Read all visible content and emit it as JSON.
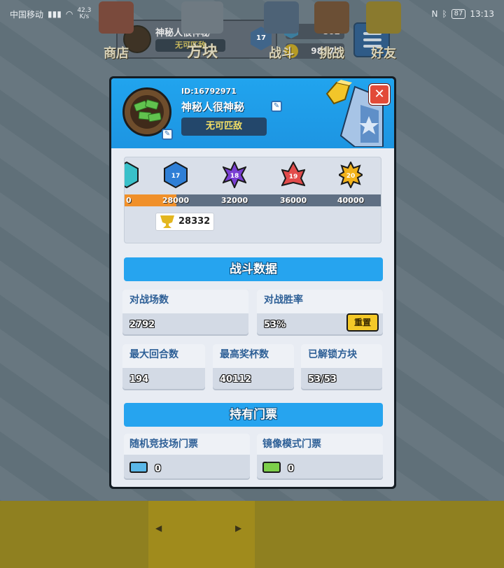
{
  "status_bar": {
    "carrier": "中国移动",
    "net_speed_value": "42.3",
    "net_speed_unit": "K/s",
    "battery": "87",
    "time": "13:13"
  },
  "background_hud": {
    "player_name": "神秘人很神秘",
    "title": "无可匹敌",
    "rank_level": "17",
    "gems": "862",
    "coins": "98176"
  },
  "bottom_nav": {
    "items": [
      {
        "label": "商店"
      },
      {
        "label": "方块"
      },
      {
        "label": "战斗"
      },
      {
        "label": "挑战"
      },
      {
        "label": "好友"
      }
    ],
    "left_arrow": "◀",
    "right_arrow": "▶"
  },
  "profile": {
    "player_id": "ID:16792971",
    "player_name": "神秘人很神秘",
    "title": "无可匹敌",
    "close_glyph": "✕"
  },
  "trophy_road": {
    "milestones": [
      {
        "trophies": "0",
        "rank": "",
        "color": "#39c0c9"
      },
      {
        "trophies": "28000",
        "rank": "17",
        "color": "#2f7fd6"
      },
      {
        "trophies": "32000",
        "rank": "18",
        "color": "#7a3fd3"
      },
      {
        "trophies": "36000",
        "rank": "19",
        "color": "#e24b4b"
      },
      {
        "trophies": "40000",
        "rank": "20",
        "color": "#f2b21b"
      }
    ],
    "current_trophies": "28332",
    "progress_fraction_of_visible_bar": 0.2
  },
  "battle_stats": {
    "section_title": "战斗数据",
    "matches": {
      "label": "对战场数",
      "value": "2792"
    },
    "win_rate": {
      "label": "对战胜率",
      "value": "53%",
      "reset_label": "重置"
    },
    "max_rounds": {
      "label": "最大回合数",
      "value": "194"
    },
    "max_trophies": {
      "label": "最高奖杯数",
      "value": "40112"
    },
    "unlocked_blocks": {
      "label": "已解锁方块",
      "value": "53/53"
    }
  },
  "tickets": {
    "section_title": "持有门票",
    "arena": {
      "label": "随机竞技场门票",
      "value": "0",
      "color": "#5ab7e8"
    },
    "mirror": {
      "label": "镜像模式门票",
      "value": "0",
      "color": "#7ccf4a"
    }
  },
  "icons": {
    "avatar": "money-avatar-icon",
    "edit": "pencil-icon",
    "trophy": "trophy-icon",
    "ticket": "ticket-icon"
  }
}
